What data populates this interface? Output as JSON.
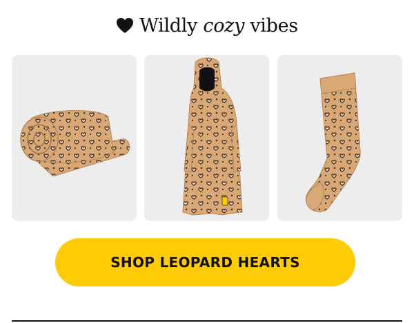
{
  "headline": {
    "heart_icon": "black-heart-icon",
    "prefix": "Wildly",
    "emphasis": "cozy",
    "suffix": "vibes"
  },
  "products": [
    {
      "icon": "rolled-leopard-blanket-image"
    },
    {
      "icon": "leopard-hooded-wearable-blanket-image"
    },
    {
      "icon": "leopard-sock-image"
    }
  ],
  "cta": {
    "label": "SHOP LEOPARD HEARTS"
  },
  "colors": {
    "accent": "#ffcb05",
    "card_background": "#ededed",
    "text": "#111111",
    "product_tan": "#d9a877",
    "leopard_spot": "#4a3122",
    "leopard_cream": "#f4e2c8"
  }
}
